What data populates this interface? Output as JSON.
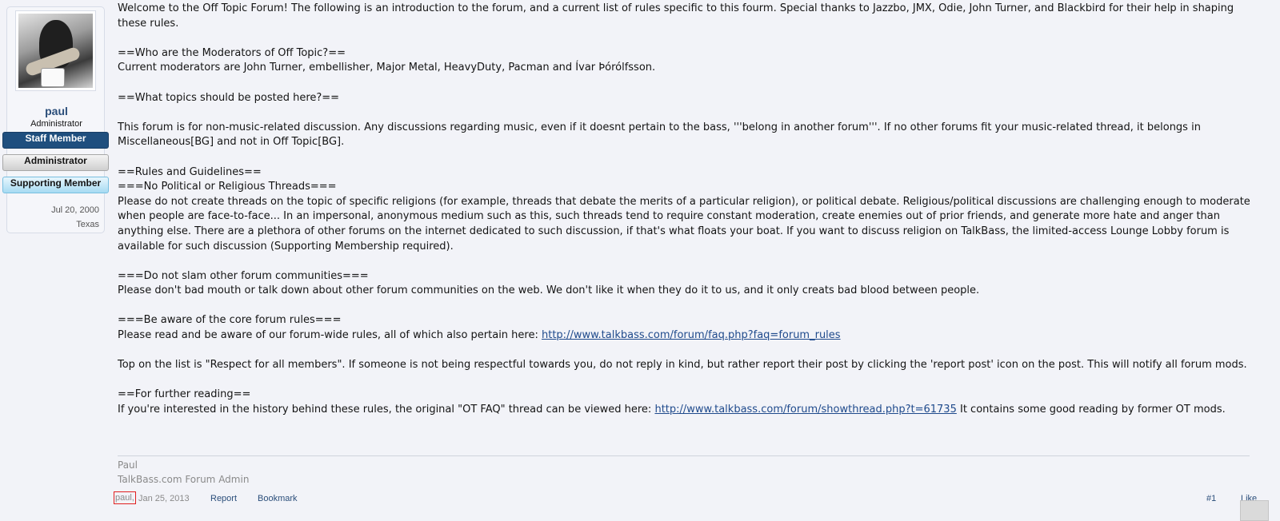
{
  "user": {
    "name": "paul",
    "title": "Administrator",
    "banners": [
      "Staff Member",
      "Administrator",
      "Supporting Member"
    ],
    "joined": "Jul 20, 2000",
    "location": "Texas"
  },
  "post": {
    "paragraphs": [
      [
        "Welcome to the Off Topic Forum! The following is an introduction to the forum, and a current list of rules specific to this fourm. Special thanks to Jazzbo, JMX, Odie, John Turner, and Blackbird for their help in shaping these rules."
      ],
      [
        "==Who are the Moderators of Off Topic?==",
        "Current moderators are John Turner, embellisher, Major Metal, HeavyDuty, Pacman and Ívar Þórólfsson."
      ],
      [
        "==What topics should be posted here?=="
      ],
      [
        "This forum is for non-music-related discussion. Any discussions regarding music, even if it doesnt pertain to the bass, '''belong in another forum'''. If no other forums fit your music-related thread, it belongs in Miscellaneous[BG] and not in Off Topic[BG]."
      ],
      [
        "==Rules and Guidelines==",
        "===No Political or Religious Threads===",
        "Please do not create threads on the topic of specific religions (for example, threads that debate the merits of a particular religion), or political debate. Religious/political discussions are challenging enough to moderate when people are face-to-face... In an impersonal, anonymous medium such as this, such threads tend to require constant moderation, create enemies out of prior friends, and generate more hate and anger than anything else. There are a plethora of other forums on the internet dedicated to such discussion, if that's what floats your boat. If you want to discuss religion on TalkBass, the limited-access Lounge Lobby forum is available for such discussion (Supporting Membership required)."
      ],
      [
        "===Do not slam other forum communities===",
        "Please don't bad mouth or talk down about other forum communities on the web. We don't like it when they do it to us, and it only creats bad blood between people."
      ]
    ],
    "core_rules_heading": "===Be aware of the core forum rules===",
    "core_rules_text": "Please read and be aware of our forum-wide rules, all of which also pertain here: ",
    "core_rules_link": "http://www.talkbass.com/forum/faq.php?faq=forum_rules",
    "respect_text": "Top on the list is \"Respect for all members\". If someone is not being respectful towards you, do not reply in kind, but rather report their post by clicking the 'report post' icon on the post. This will notify all forum mods.",
    "further_heading": "==For further reading==",
    "further_text_before": "If you're interested in the history behind these rules, the original \"OT FAQ\" thread can be viewed here: ",
    "further_link": "http://www.talkbass.com/forum/showthread.php?t=61735",
    "further_text_after": " It contains some good reading by former OT mods."
  },
  "signature": {
    "line1": "Paul",
    "line2": "TalkBass.com Forum Admin"
  },
  "meta": {
    "author": "paul,",
    "date": "Jan 25, 2013",
    "report": "Report",
    "bookmark": "Bookmark",
    "post_number": "#1",
    "like": "Like"
  }
}
